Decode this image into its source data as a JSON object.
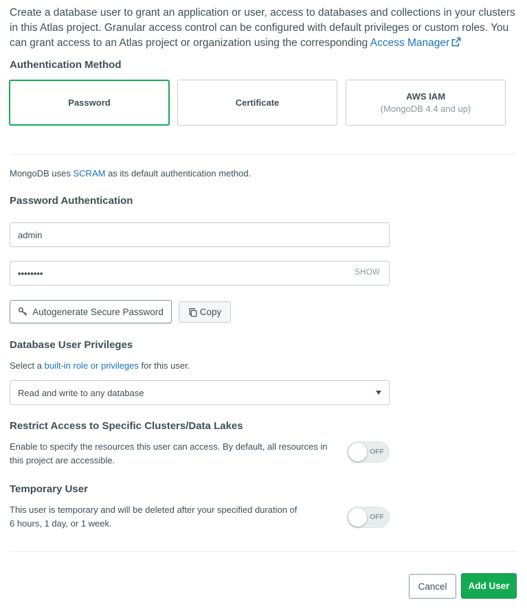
{
  "intro": {
    "text": "Create a database user to grant an application or user, access to databases and collections in your clusters in this Atlas project. Granular access control can be configured with default privileges or custom roles. You can grant access to an Atlas project or organization using the corresponding ",
    "link": "Access Manager"
  },
  "auth_method": {
    "heading": "Authentication Method",
    "options": [
      {
        "title": "Password",
        "subtitle": ""
      },
      {
        "title": "Certificate",
        "subtitle": ""
      },
      {
        "title": "AWS IAM",
        "subtitle": "(MongoDB 4.4 and up)"
      }
    ],
    "selected": "Password"
  },
  "scram_note": {
    "before": "MongoDB uses ",
    "link": "SCRAM",
    "after": " as its default authentication method."
  },
  "password_auth": {
    "heading": "Password Authentication",
    "username_value": "admin",
    "password_value": "••••••••",
    "show_label": "SHOW",
    "autogenerate_label": "Autogenerate Secure Password",
    "copy_label": "Copy"
  },
  "privileges": {
    "heading": "Database User Privileges",
    "desc_before": "Select a ",
    "desc_link": "built-in role or privileges",
    "desc_after": " for this user.",
    "selected_role": "Read and write to any database"
  },
  "restrict": {
    "heading": "Restrict Access to Specific Clusters/Data Lakes",
    "desc": "Enable to specify the resources this user can access. By default, all resources in this project are accessible.",
    "toggle_label": "OFF",
    "enabled": false
  },
  "temporary": {
    "heading": "Temporary User",
    "desc_line1": "This user is temporary and will be deleted after your specified duration of",
    "desc_line2": "6 hours, 1 day, or 1 week.",
    "toggle_label": "OFF",
    "enabled": false
  },
  "footer": {
    "cancel_label": "Cancel",
    "add_label": "Add User"
  },
  "colors": {
    "accent": "#13aa52",
    "link": "#1a73b8",
    "text": "#3d4f58",
    "muted": "#89989b"
  }
}
